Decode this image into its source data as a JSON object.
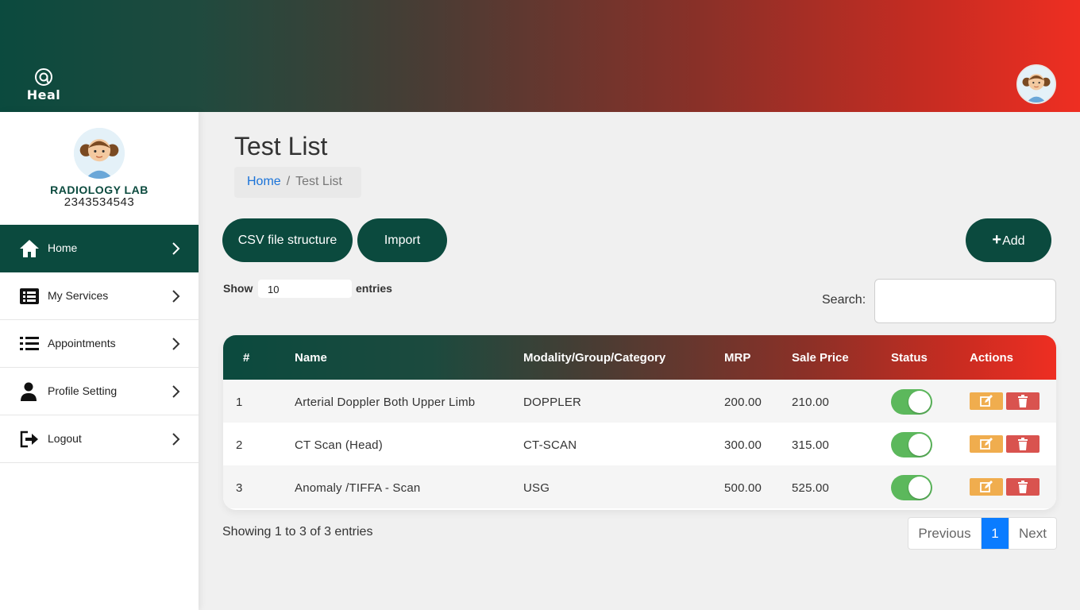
{
  "header": {
    "logo_text": "Heal",
    "colors": {
      "brand": "#0b4a3e",
      "accent": "#ee2e22"
    }
  },
  "sidebar": {
    "lab_name": "RADIOLOGY LAB",
    "lab_phone": "2343534543",
    "items": [
      {
        "label": "Home",
        "icon": "home-icon",
        "active": true
      },
      {
        "label": "My Services",
        "icon": "list-box-icon",
        "active": false
      },
      {
        "label": "Appointments",
        "icon": "list-icon",
        "active": false
      },
      {
        "label": "Profile Setting",
        "icon": "user-icon",
        "active": false
      },
      {
        "label": "Logout",
        "icon": "logout-icon",
        "active": false
      }
    ]
  },
  "main": {
    "title": "Test List",
    "breadcrumb": {
      "home": "Home",
      "separator": "/",
      "current": "Test List"
    },
    "buttons": {
      "csv": "CSV file structure",
      "import": "Import",
      "add": "Add"
    },
    "show_label": "Show",
    "entries_value": "10",
    "entries_label": "entries",
    "search_label": "Search:",
    "search_value": "",
    "table": {
      "headers": [
        "#",
        "Name",
        "Modality/Group/Category",
        "MRP",
        "Sale Price",
        "Status",
        "Actions"
      ],
      "rows": [
        {
          "num": "1",
          "name": "Arterial Doppler Both Upper Limb",
          "category": "DOPPLER",
          "mrp": "200.00",
          "sale": "210.00",
          "status": true
        },
        {
          "num": "2",
          "name": "CT Scan (Head)",
          "category": "CT-SCAN",
          "mrp": "300.00",
          "sale": "315.00",
          "status": true
        },
        {
          "num": "3",
          "name": "Anomaly /TIFFA - Scan",
          "category": "USG",
          "mrp": "500.00",
          "sale": "525.00",
          "status": true
        }
      ]
    },
    "footer": {
      "showing": "Showing 1 to 3 of 3 entries",
      "previous": "Previous",
      "current_page": "1",
      "next": "Next"
    }
  }
}
